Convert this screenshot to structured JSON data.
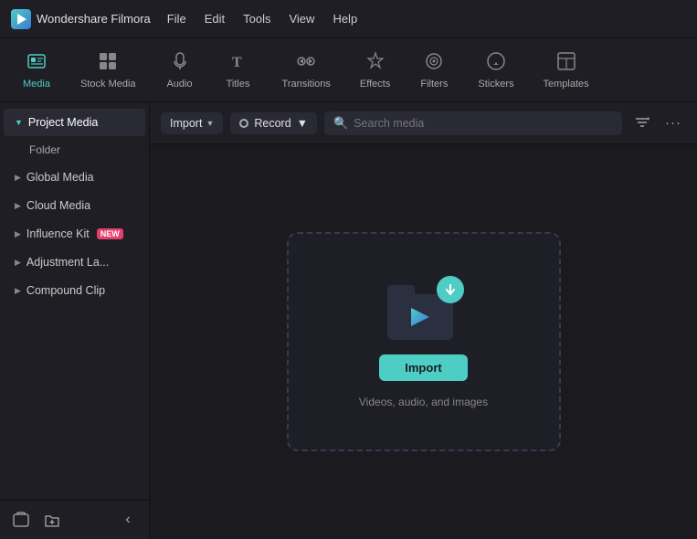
{
  "app": {
    "name": "Wondershare Filmora",
    "logo_char": "▶"
  },
  "menu": {
    "items": [
      "File",
      "Edit",
      "Tools",
      "View",
      "Help"
    ]
  },
  "nav_tabs": [
    {
      "id": "media",
      "label": "Media",
      "icon": "⊞",
      "active": true
    },
    {
      "id": "stock-media",
      "label": "Stock Media",
      "icon": "🖼"
    },
    {
      "id": "audio",
      "label": "Audio",
      "icon": "♪"
    },
    {
      "id": "titles",
      "label": "Titles",
      "icon": "T"
    },
    {
      "id": "transitions",
      "label": "Transitions",
      "icon": "⇄"
    },
    {
      "id": "effects",
      "label": "Effects",
      "icon": "✦"
    },
    {
      "id": "filters",
      "label": "Filters",
      "icon": "⬡"
    },
    {
      "id": "stickers",
      "label": "Stickers",
      "icon": "★"
    },
    {
      "id": "templates",
      "label": "Templates",
      "icon": "▣"
    }
  ],
  "sidebar": {
    "project_media": {
      "label": "Project Media",
      "active": true,
      "sub_items": [
        "Folder"
      ]
    },
    "items": [
      {
        "id": "global-media",
        "label": "Global Media",
        "badge": null
      },
      {
        "id": "cloud-media",
        "label": "Cloud Media",
        "badge": null
      },
      {
        "id": "influence-kit",
        "label": "Influence Kit",
        "badge": "NEW"
      },
      {
        "id": "adjustment-la",
        "label": "Adjustment La...",
        "badge": null
      },
      {
        "id": "compound-clip",
        "label": "Compound Clip",
        "badge": null
      }
    ],
    "bottom_buttons": [
      {
        "id": "new-bin",
        "icon": "⊡"
      },
      {
        "id": "new-folder",
        "icon": "📁"
      }
    ],
    "collapse_icon": "‹"
  },
  "toolbar": {
    "import_label": "Import",
    "record_label": "Record",
    "search_placeholder": "Search media",
    "filter_icon": "⊟",
    "more_icon": "•••"
  },
  "import_area": {
    "button_label": "Import",
    "description": "Videos, audio, and images",
    "arrow_icon": "↙",
    "filmora_icon": "✦"
  }
}
